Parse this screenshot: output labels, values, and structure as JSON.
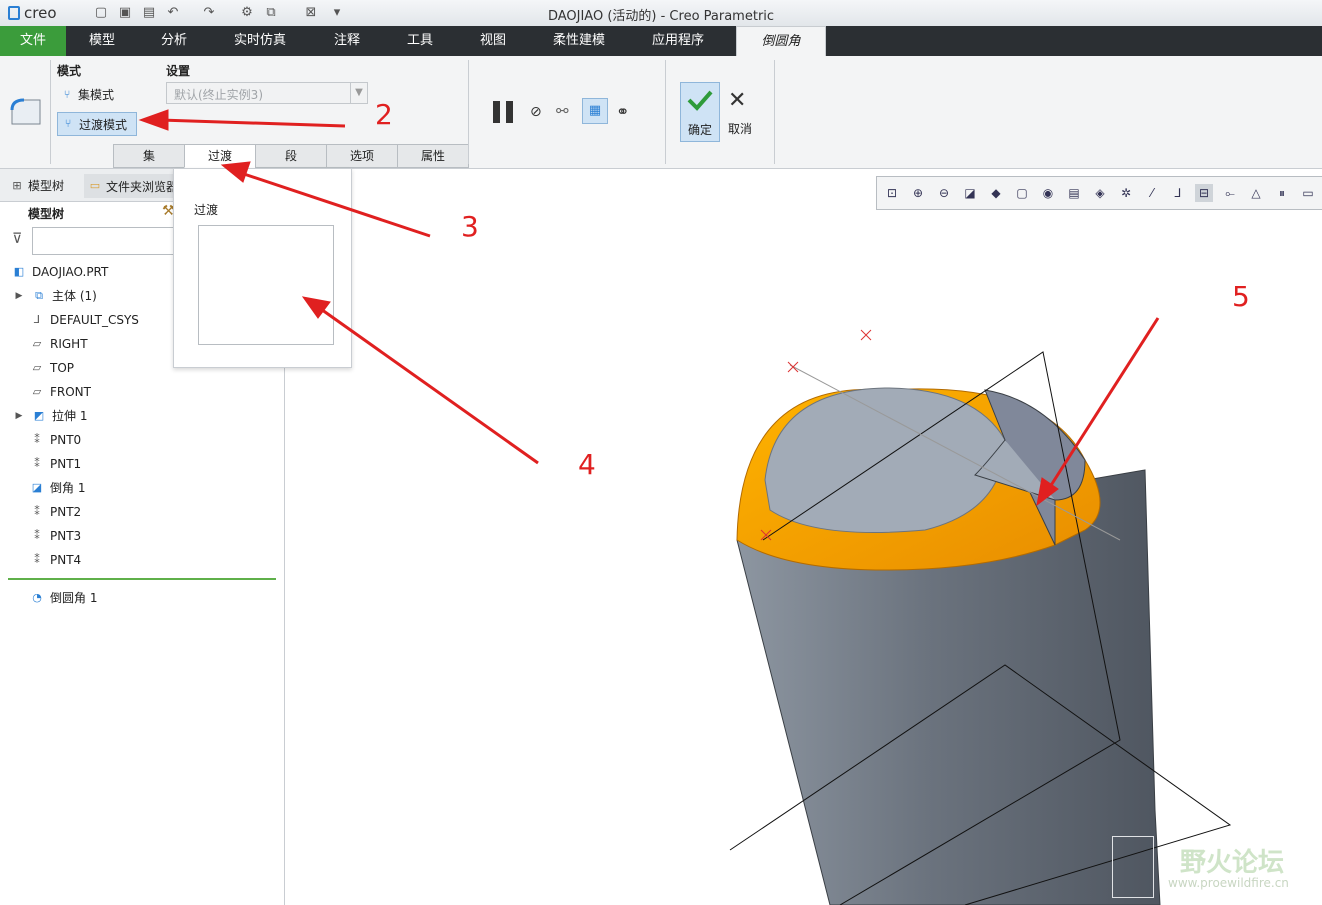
{
  "app": {
    "logo": "creo",
    "window_title": "DAOJIAO (活动的) - Creo Parametric"
  },
  "menu": {
    "items": [
      "文件",
      "模型",
      "分析",
      "实时仿真",
      "注释",
      "工具",
      "视图",
      "柔性建模",
      "应用程序",
      "倒圆角"
    ]
  },
  "ribbon": {
    "mode_label": "模式",
    "set_mode": "集模式",
    "transition_mode": "过渡模式",
    "settings_label": "设置",
    "settings_value": "默认(终止实例3)",
    "confirm": "确定",
    "cancel": "取消",
    "subtabs": [
      "集",
      "过渡",
      "段",
      "选项",
      "属性"
    ]
  },
  "popup": {
    "label": "过渡"
  },
  "leftpanel": {
    "tab_model_tree": "模型树",
    "tab_folder_browser": "文件夹浏览器",
    "tree_header": "模型树",
    "items": [
      "DAOJIAO.PRT",
      "主体 (1)",
      "DEFAULT_CSYS",
      "RIGHT",
      "TOP",
      "FRONT",
      "拉伸 1",
      "PNT0",
      "PNT1",
      "倒角 1",
      "PNT2",
      "PNT3",
      "PNT4"
    ],
    "insert_item": "倒圆角 1"
  },
  "annotations": [
    "2",
    "3",
    "4",
    "5"
  ],
  "watermark": {
    "title": "野火论坛",
    "url": "www.proewildfire.cn"
  },
  "colors": {
    "accent": "#3b9c3b",
    "menu_bg": "#2b2f33",
    "highlight": "#f5a300",
    "model": "#6f7782"
  }
}
